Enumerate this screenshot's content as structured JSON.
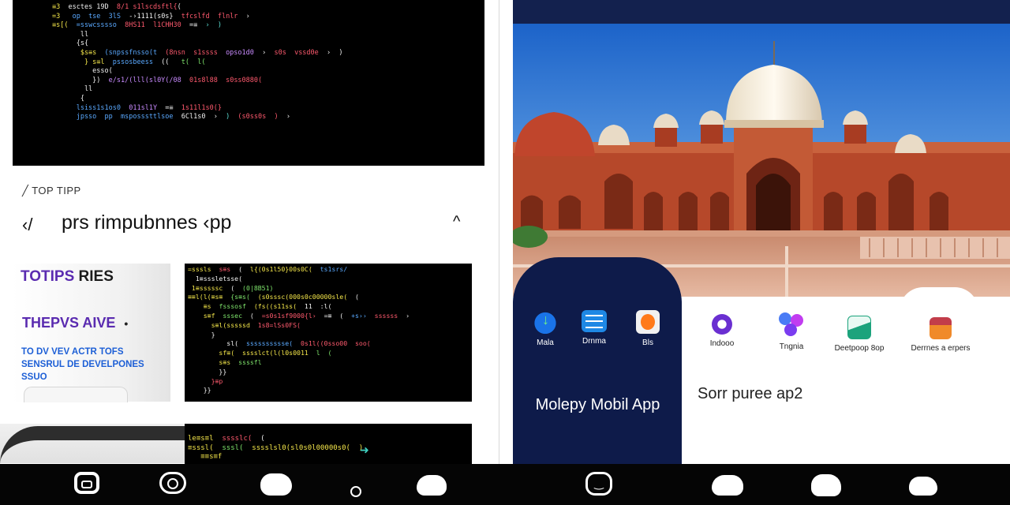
{
  "code_panel_top": {
    "lines": [
      [
        {
          "t": "≡3  ",
          "c": "c-y"
        },
        {
          "t": "esctes 19D  ",
          "c": "c-w"
        },
        {
          "t": "8/1 s1lscdsftl{",
          "c": "c-r"
        },
        {
          "t": "(",
          "c": "c-w"
        }
      ],
      [
        {
          "t": "=3   ",
          "c": "c-y"
        },
        {
          "t": "op  tse  3lS  ",
          "c": "c-b"
        },
        {
          "t": "-›1111(s0s}  ",
          "c": "c-w"
        },
        {
          "t": "tfcslfd  flnlr  ",
          "c": "c-r"
        },
        {
          "t": "›",
          "c": "c-w"
        }
      ],
      [
        {
          "t": "≡s[(  ",
          "c": "c-y"
        },
        {
          "t": "=sswcsssso  ",
          "c": "c-b"
        },
        {
          "t": "8HS11  l1CHH30  ",
          "c": "c-r"
        },
        {
          "t": "=≡  ",
          "c": "c-w"
        },
        {
          "t": "›  )",
          "c": "c-c"
        }
      ],
      [
        {
          "t": "       ll",
          "c": "c-w"
        }
      ],
      [
        {
          "t": "      {s{",
          "c": "c-w"
        }
      ],
      [
        {
          "t": "       $s≡s  ",
          "c": "c-y"
        },
        {
          "t": "(snpssfnsso(t  ",
          "c": "c-b"
        },
        {
          "t": "(8nsn  s1ssss  ",
          "c": "c-r"
        },
        {
          "t": "opso1d0  ",
          "c": "c-p"
        },
        {
          "t": "›  ",
          "c": "c-w"
        },
        {
          "t": "s0s  vssd0e  ",
          "c": "c-r"
        },
        {
          "t": "›  )",
          "c": "c-w"
        }
      ],
      [
        {
          "t": "        } s≡l  ",
          "c": "c-y"
        },
        {
          "t": "pssosbeess  ",
          "c": "c-b"
        },
        {
          "t": "((   ",
          "c": "c-w"
        },
        {
          "t": "t(  l(",
          "c": "c-g"
        }
      ],
      [
        {
          "t": "          esso(",
          "c": "c-w"
        }
      ],
      [
        {
          "t": "          })  ",
          "c": "c-w"
        },
        {
          "t": "e/s1/(lll(sl0Y(/08  ",
          "c": "c-p"
        },
        {
          "t": "01s8l88  ",
          "c": "c-r"
        },
        {
          "t": "s0ss0880(",
          "c": "c-r"
        }
      ],
      [
        {
          "t": "        ll",
          "c": "c-w"
        }
      ],
      [
        {
          "t": "       {",
          "c": "c-w"
        }
      ],
      [
        {
          "t": "      lsiss1s1os0  ",
          "c": "c-b"
        },
        {
          "t": "011sl1Y  ",
          "c": "c-p"
        },
        {
          "t": "=≡  ",
          "c": "c-w"
        },
        {
          "t": "1s11l1s0(}",
          "c": "c-r"
        }
      ],
      [
        {
          "t": "      jpsso  pp  msposssttlsoe  ",
          "c": "c-b"
        },
        {
          "t": "6Cl1s0  ›  ",
          "c": "c-w"
        },
        {
          "t": ")  ",
          "c": "c-c"
        },
        {
          "t": "(s0ss0s  )  ",
          "c": "c-r"
        },
        {
          "t": "›",
          "c": "c-w"
        }
      ]
    ]
  },
  "code_panel_mid": {
    "lines": [
      [
        {
          "t": "=sssls  ",
          "c": "c-y"
        },
        {
          "t": "s≡s  ",
          "c": "c-r"
        },
        {
          "t": "(  ",
          "c": "c-w"
        },
        {
          "t": "l{(0s1l50}00s0C(  ",
          "c": "c-y"
        },
        {
          "t": "ts1srs/",
          "c": "c-b"
        }
      ],
      [
        {
          "t": "  1≡sssletsse(",
          "c": "c-w"
        }
      ],
      [
        {
          "t": " 1≡sssssc  ",
          "c": "c-y"
        },
        {
          "t": "(  ",
          "c": "c-w"
        },
        {
          "t": "(0|8B51)",
          "c": "c-g"
        }
      ],
      [
        {
          "t": "≡≡l(l(≡s≡  ",
          "c": "c-y"
        },
        {
          "t": "{s≡s(  ",
          "c": "c-g"
        },
        {
          "t": "(s0sssc(000s0c00000sle(  ",
          "c": "c-y"
        },
        {
          "t": "(",
          "c": "c-w"
        }
      ],
      [
        {
          "t": "    ≡s  ",
          "c": "c-y"
        },
        {
          "t": "fsssosf  ",
          "c": "c-g"
        },
        {
          "t": "(fs((s11ss(  ",
          "c": "c-y"
        },
        {
          "t": "11  ",
          "c": "c-w"
        },
        {
          "t": ":l(  ",
          "c": "c-w"
        }
      ],
      [
        {
          "t": "    s≡f  ",
          "c": "c-y"
        },
        {
          "t": "sssec  ",
          "c": "c-g"
        },
        {
          "t": "(  ",
          "c": "c-w"
        },
        {
          "t": "=s0s1sf9000{l›  ",
          "c": "c-r"
        },
        {
          "t": "=≡  ",
          "c": "c-w"
        },
        {
          "t": "(  ",
          "c": "c-w"
        },
        {
          "t": "+s››  ",
          "c": "c-b"
        },
        {
          "t": "ssssss  ",
          "c": "c-r"
        },
        {
          "t": "›",
          "c": "c-w"
        }
      ],
      [
        {
          "t": "      s≡l(sssssd  ",
          "c": "c-y"
        },
        {
          "t": "1s8=lSs0FS(",
          "c": "c-r"
        }
      ],
      [
        {
          "t": "      }",
          "c": "c-w"
        }
      ],
      [
        {
          "t": "          sl(  ",
          "c": "c-w"
        },
        {
          "t": "sssssssssse(  ",
          "c": "c-b"
        },
        {
          "t": "0s1l((0sso00  ",
          "c": "c-r"
        },
        {
          "t": "soo(",
          "c": "c-r"
        }
      ],
      [
        {
          "t": "        sf≡(  ",
          "c": "c-y"
        },
        {
          "t": "sssslct(l(l0s0011  ",
          "c": "c-y"
        },
        {
          "t": "l  (",
          "c": "c-g"
        }
      ],
      [
        {
          "t": "        s≡s  ",
          "c": "c-y"
        },
        {
          "t": "ssssfl",
          "c": "c-g"
        }
      ],
      [
        {
          "t": "        }}",
          "c": "c-w"
        }
      ],
      [
        {
          "t": "      }≡p",
          "c": "c-r"
        }
      ],
      [
        {
          "t": "    }}",
          "c": "c-w"
        }
      ]
    ]
  },
  "code_panel_bottom": {
    "lines": [
      [
        {
          "t": "le≡s≡l  ",
          "c": "c-y"
        },
        {
          "t": "sssslc(  ",
          "c": "c-r"
        },
        {
          "t": "(",
          "c": "c-w"
        }
      ],
      [
        {
          "t": "≡sssl(  ",
          "c": "c-y"
        },
        {
          "t": "sssl(  ",
          "c": "c-g"
        },
        {
          "t": "sssslsl0(sl0s0l00000s0(  )",
          "c": "c-y"
        }
      ],
      [
        {
          "t": "   ≡≡s≡f",
          "c": "c-y"
        }
      ]
    ]
  },
  "article": {
    "tag": "╱ TOP TIPP",
    "headline": "prs rimpubnnes ‹pp",
    "back_label": "‹/",
    "chevron_label": "^"
  },
  "card": {
    "title_line1_a": "TO",
    "title_line1_b": "TIPS",
    "title_line1_c": " RIES",
    "title_line2": "THEPVS AIVE",
    "bullet": "•",
    "desc_lines": [
      "TO DV VEV ACTR TOFS",
      "SENSRUL DE DEVELPONES",
      "SSUO"
    ]
  },
  "panel": {
    "title": "Molepy Mobil App",
    "apps": [
      {
        "label": "Mala",
        "icon": "download-icon",
        "color": "#1a73e8"
      },
      {
        "label": "Drnma",
        "icon": "list-icon",
        "color": "#1e88e5"
      },
      {
        "label": "Bls",
        "icon": "bookmark-icon",
        "color": "#ff7a1a"
      }
    ]
  },
  "right_apps": [
    {
      "label": "Indooo",
      "icon": "chat-icon",
      "color": "#6a2fd1"
    },
    {
      "label": "Tngnia",
      "icon": "cluster-icon",
      "color": "#7a3cf0"
    },
    {
      "label": "Deetpoop 8op",
      "icon": "image-icon",
      "color": "#1ca37c"
    },
    {
      "label": "Derrnes a erpers",
      "icon": "folder-icon",
      "color": "#e0531c"
    }
  ],
  "side_title": "Sorr puree ap2",
  "navbar": {
    "icons": [
      "app-drawer-icon",
      "camera-icon",
      "cloud-icon",
      "home-dot-icon",
      "cloud-icon",
      "smile-icon",
      "cloud-icon",
      "cloud-icon",
      "cloud-icon"
    ]
  }
}
